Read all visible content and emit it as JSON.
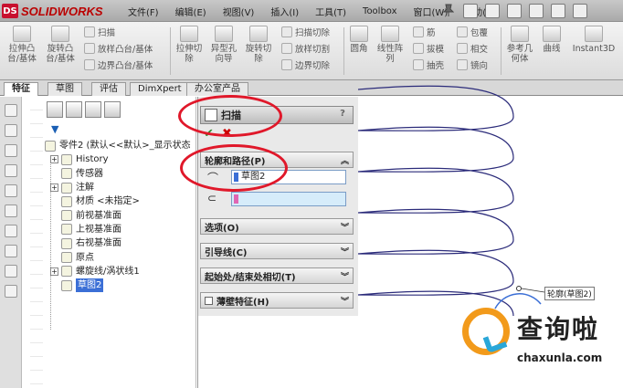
{
  "app": {
    "logo_text": "SOLIDWORKS"
  },
  "menu": [
    "文件(F)",
    "编辑(E)",
    "视图(V)",
    "插入(I)",
    "工具(T)",
    "Toolbox",
    "窗口(W)",
    "帮助(H)"
  ],
  "commands": {
    "extrude_boss": "拉伸凸\n台/基体",
    "revolve_boss": "旋转凸\n台/基体",
    "sweep": "扫描",
    "loft_boss": "放样凸台/基体",
    "boundary_boss": "边界凸台/基体",
    "extrude_cut": "拉伸切\n除",
    "hole_wizard": "异型孔\n向导",
    "revolve_cut": "旋转切\n除",
    "sweep_cut": "扫描切除",
    "loft_cut": "放样切割",
    "boundary_cut": "边界切除",
    "fillet": "圆角",
    "linear_pattern": "线性阵\n列",
    "rib": "筋",
    "draft": "拔模",
    "shell": "抽壳",
    "wrap": "包覆",
    "intersect": "相交",
    "mirror": "镜向",
    "ref_geometry": "参考几\n何体",
    "curves": "曲线",
    "instant3d": "Instant3D"
  },
  "tabs": [
    {
      "label": "特征",
      "active": true
    },
    {
      "label": "草图",
      "active": false
    },
    {
      "label": "评估",
      "active": false
    },
    {
      "label": "DimXpert",
      "active": false
    },
    {
      "label": "办公室产品",
      "active": false
    }
  ],
  "tree": {
    "root": "零件2  (默认<<默认>_显示状态",
    "items": [
      {
        "label": "History",
        "expandable": true
      },
      {
        "label": "传感器",
        "expandable": false
      },
      {
        "label": "注解",
        "expandable": true
      },
      {
        "label": "材质 <未指定>",
        "expandable": false
      },
      {
        "label": "前视基准面",
        "expandable": false
      },
      {
        "label": "上视基准面",
        "expandable": false
      },
      {
        "label": "右视基准面",
        "expandable": false
      },
      {
        "label": "原点",
        "expandable": false
      },
      {
        "label": "螺旋线/涡状线1",
        "expandable": true
      },
      {
        "label": "草图2",
        "expandable": false,
        "selected": true
      }
    ]
  },
  "property_manager": {
    "title": "扫描",
    "help": "?",
    "ok": "✔",
    "cancel": "✖",
    "section_profile_path": "轮廓和路径(P)",
    "profile_value": "草图2",
    "path_value": "",
    "sections": [
      "选项(O)",
      "引导线(C)",
      "起始处/结束处相切(T)",
      "薄壁特征(H)"
    ]
  },
  "graphics": {
    "profile_label": "轮廓(草图2)"
  },
  "watermark": {
    "text": "查询啦",
    "url": "chaxunla.com"
  },
  "colors": {
    "accent_red": "#e0182a",
    "helix": "#2b2b7a",
    "selection": "#3b6fd6"
  }
}
